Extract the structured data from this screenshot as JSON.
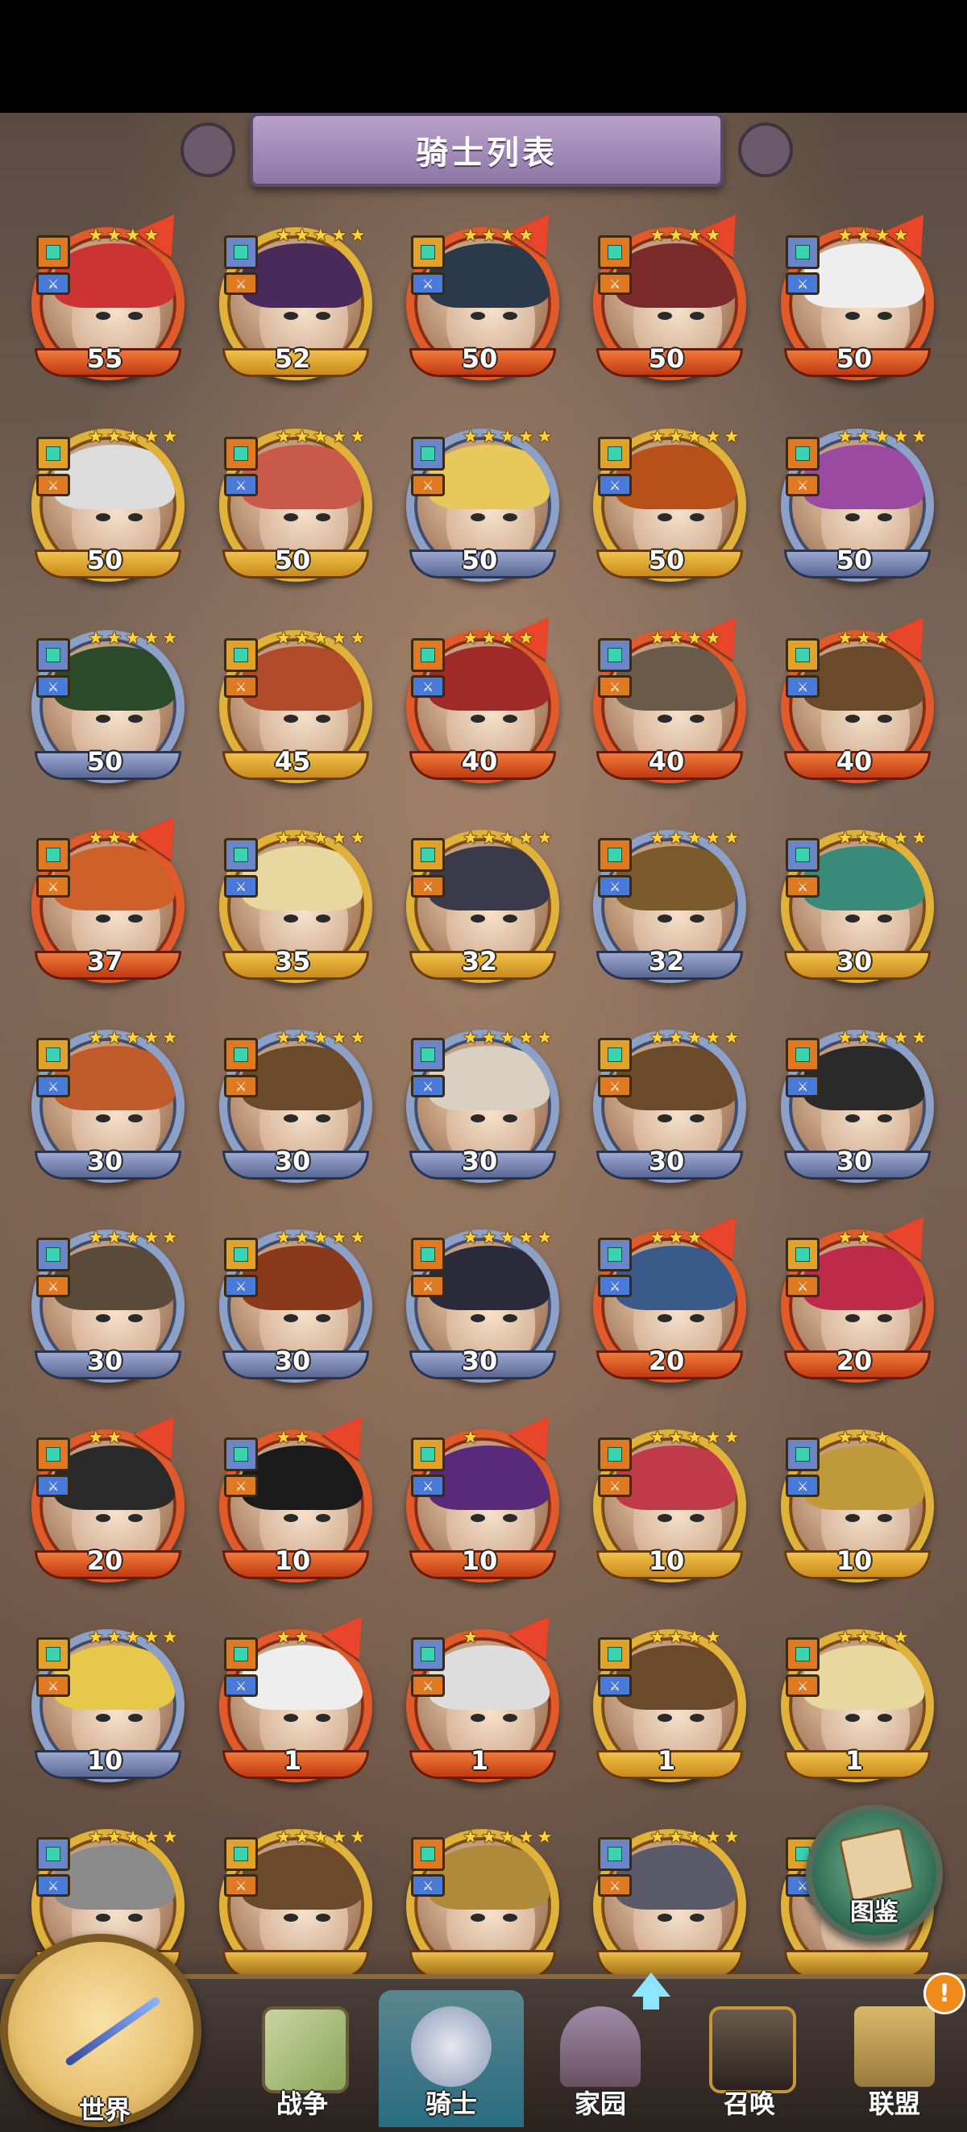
{
  "title": "骑士列表",
  "codex_label": "图鉴",
  "nav": {
    "world": "世界",
    "war": "战争",
    "knight": "骑士",
    "home": "家园",
    "summon": "召唤",
    "alliance": "联盟",
    "alert": "!"
  },
  "heroes": [
    {
      "level": "55",
      "stars": 4,
      "frame": "red",
      "flag": true,
      "color": "#c33"
    },
    {
      "level": "52",
      "stars": 5,
      "frame": "gold",
      "flag": false,
      "color": "#4a2a5a"
    },
    {
      "level": "50",
      "stars": 4,
      "frame": "red",
      "flag": true,
      "color": "#2a3a4a"
    },
    {
      "level": "50",
      "stars": 4,
      "frame": "red",
      "flag": true,
      "color": "#7a2a2a"
    },
    {
      "level": "50",
      "stars": 4,
      "frame": "red",
      "flag": true,
      "color": "#eee"
    },
    {
      "level": "50",
      "stars": 5,
      "frame": "gold",
      "flag": false,
      "color": "#ddd"
    },
    {
      "level": "50",
      "stars": 5,
      "frame": "gold",
      "flag": false,
      "color": "#c95a4a"
    },
    {
      "level": "50",
      "stars": 5,
      "frame": "blue",
      "flag": false,
      "color": "#e8c85a"
    },
    {
      "level": "50",
      "stars": 5,
      "frame": "gold",
      "flag": false,
      "color": "#b8501a"
    },
    {
      "level": "50",
      "stars": 5,
      "frame": "blue",
      "flag": false,
      "color": "#9a4aa0"
    },
    {
      "level": "50",
      "stars": 5,
      "frame": "blue",
      "flag": false,
      "color": "#2a4a2a"
    },
    {
      "level": "45",
      "stars": 5,
      "frame": "gold",
      "flag": false,
      "color": "#b04a2a"
    },
    {
      "level": "40",
      "stars": 4,
      "frame": "red",
      "flag": true,
      "color": "#a02a2a"
    },
    {
      "level": "40",
      "stars": 4,
      "frame": "red",
      "flag": true,
      "color": "#6a5a4a"
    },
    {
      "level": "40",
      "stars": 3,
      "frame": "red",
      "flag": true,
      "color": "#6a4a2a"
    },
    {
      "level": "37",
      "stars": 3,
      "frame": "red",
      "flag": true,
      "color": "#d0602a"
    },
    {
      "level": "35",
      "stars": 5,
      "frame": "gold",
      "flag": false,
      "color": "#e8d8a0"
    },
    {
      "level": "32",
      "stars": 5,
      "frame": "gold",
      "flag": false,
      "color": "#3a3a4a"
    },
    {
      "level": "32",
      "stars": 5,
      "frame": "blue",
      "flag": false,
      "color": "#7a5a2a"
    },
    {
      "level": "30",
      "stars": 5,
      "frame": "gold",
      "flag": false,
      "color": "#3a8a7a"
    },
    {
      "level": "30",
      "stars": 5,
      "frame": "blue",
      "flag": false,
      "color": "#c05a2a"
    },
    {
      "level": "30",
      "stars": 5,
      "frame": "blue",
      "flag": false,
      "color": "#6a4a2a"
    },
    {
      "level": "30",
      "stars": 5,
      "frame": "blue",
      "flag": false,
      "color": "#d8d0c0"
    },
    {
      "level": "30",
      "stars": 5,
      "frame": "blue",
      "flag": false,
      "color": "#6a4a2a"
    },
    {
      "level": "30",
      "stars": 5,
      "frame": "blue",
      "flag": false,
      "color": "#2a2a2a"
    },
    {
      "level": "30",
      "stars": 5,
      "frame": "blue",
      "flag": false,
      "color": "#5a4a3a"
    },
    {
      "level": "30",
      "stars": 5,
      "frame": "blue",
      "flag": false,
      "color": "#8a3a1a"
    },
    {
      "level": "30",
      "stars": 5,
      "frame": "blue",
      "flag": false,
      "color": "#2a2a3a"
    },
    {
      "level": "20",
      "stars": 3,
      "frame": "red",
      "flag": true,
      "color": "#3a5a8a"
    },
    {
      "level": "20",
      "stars": 2,
      "frame": "red",
      "flag": true,
      "color": "#c02a4a"
    },
    {
      "level": "20",
      "stars": 2,
      "frame": "red",
      "flag": true,
      "color": "#2a2a2a"
    },
    {
      "level": "10",
      "stars": 2,
      "frame": "red",
      "flag": true,
      "color": "#1a1a1a"
    },
    {
      "level": "10",
      "stars": 1,
      "frame": "red",
      "flag": true,
      "color": "#5a2a7a"
    },
    {
      "level": "10",
      "stars": 5,
      "frame": "gold",
      "flag": false,
      "color": "#c03a4a"
    },
    {
      "level": "10",
      "stars": 3,
      "frame": "gold",
      "flag": false,
      "color": "#c09a3a"
    },
    {
      "level": "10",
      "stars": 5,
      "frame": "blue",
      "flag": false,
      "color": "#e8c84a"
    },
    {
      "level": "1",
      "stars": 2,
      "frame": "red",
      "flag": true,
      "color": "#eeeeee"
    },
    {
      "level": "1",
      "stars": 1,
      "frame": "red",
      "flag": true,
      "color": "#dddddd"
    },
    {
      "level": "1",
      "stars": 4,
      "frame": "gold",
      "flag": false,
      "color": "#6a4a2a"
    },
    {
      "level": "1",
      "stars": 4,
      "frame": "gold",
      "flag": false,
      "color": "#e8d8a0"
    },
    {
      "level": "",
      "stars": 5,
      "frame": "gold",
      "flag": false,
      "color": "#8a8a8a"
    },
    {
      "level": "",
      "stars": 5,
      "frame": "gold",
      "flag": false,
      "color": "#6a4a2a"
    },
    {
      "level": "",
      "stars": 5,
      "frame": "gold",
      "flag": false,
      "color": "#b08a3a"
    },
    {
      "level": "",
      "stars": 5,
      "frame": "gold",
      "flag": false,
      "color": "#5a5a6a"
    },
    {
      "level": "",
      "stars": 5,
      "frame": "gold",
      "flag": false,
      "color": "#8a7a6a"
    }
  ]
}
